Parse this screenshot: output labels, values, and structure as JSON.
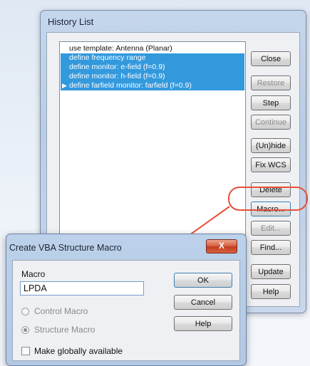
{
  "history_window": {
    "title": "History List",
    "items": [
      {
        "text": "use template: Antenna (Planar)",
        "selected": false
      },
      {
        "text": "define frequency range",
        "selected": true
      },
      {
        "text": "define monitor: e-field (f=0.9)",
        "selected": true
      },
      {
        "text": "define monitor: h-field (f=0.9)",
        "selected": true
      },
      {
        "text": "define farfield monitor: farfield (f=0.9)",
        "selected": true,
        "current": true
      }
    ],
    "buttons": {
      "close": "Close",
      "restore": "Restore",
      "step": "Step",
      "continue": "Continue",
      "unhide": "(Un)hide",
      "fixwcs": "Fix WCS",
      "delete": "Delete",
      "macro": "Macro...",
      "edit": "Edit...",
      "find": "Find...",
      "update": "Update",
      "help": "Help"
    }
  },
  "dialog": {
    "title": "Create VBA Structure Macro",
    "close_label": "X",
    "macro_label": "Macro",
    "macro_value": "LPDA",
    "radio_control": "Control Macro",
    "radio_structure": "Structure Macro",
    "checkbox_global": "Make globally available",
    "ok": "OK",
    "cancel": "Cancel",
    "help": "Help"
  },
  "colors": {
    "selection": "#3399dd",
    "annotation": "#e8503a"
  },
  "icons": {
    "current_item": "triangle-right-icon"
  }
}
